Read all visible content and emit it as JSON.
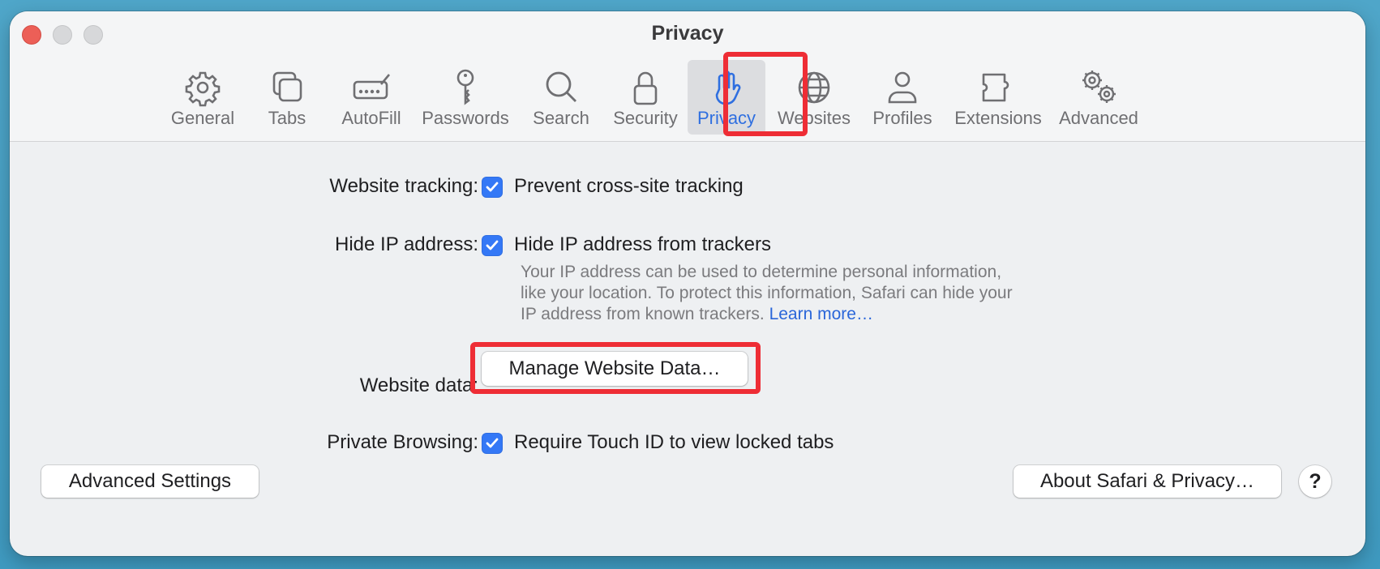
{
  "window": {
    "title": "Privacy"
  },
  "toolbar": {
    "items": [
      {
        "label": "General",
        "icon": "gear-icon"
      },
      {
        "label": "Tabs",
        "icon": "tabs-icon"
      },
      {
        "label": "AutoFill",
        "icon": "autofill-icon"
      },
      {
        "label": "Passwords",
        "icon": "key-icon"
      },
      {
        "label": "Search",
        "icon": "search-icon"
      },
      {
        "label": "Security",
        "icon": "lock-icon"
      },
      {
        "label": "Privacy",
        "icon": "hand-icon",
        "selected": true
      },
      {
        "label": "Websites",
        "icon": "globe-icon"
      },
      {
        "label": "Profiles",
        "icon": "person-icon"
      },
      {
        "label": "Extensions",
        "icon": "puzzle-icon"
      },
      {
        "label": "Advanced",
        "icon": "gears-icon"
      }
    ]
  },
  "settings": {
    "website_tracking": {
      "label": "Website tracking:",
      "checkbox": "Prevent cross-site tracking",
      "checked": true
    },
    "hide_ip": {
      "label": "Hide IP address:",
      "checkbox": "Hide IP address from trackers",
      "checked": true,
      "description_1": "Your IP address can be used to determine personal information,",
      "description_2": "like your location. To protect this information, Safari can hide your",
      "description_3": "IP address from known trackers.",
      "learn_more": "Learn more…"
    },
    "website_data": {
      "label": "Website data:",
      "button": "Manage Website Data…"
    },
    "private_browsing": {
      "label": "Private Browsing:",
      "checkbox": "Require Touch ID to view locked tabs",
      "checked": true
    }
  },
  "footer": {
    "advanced_settings": "Advanced Settings",
    "about": "About Safari & Privacy…",
    "help": "?"
  },
  "colors": {
    "accent": "#3478f6",
    "highlight_box": "#ee2d35",
    "link": "#2a66d9"
  }
}
